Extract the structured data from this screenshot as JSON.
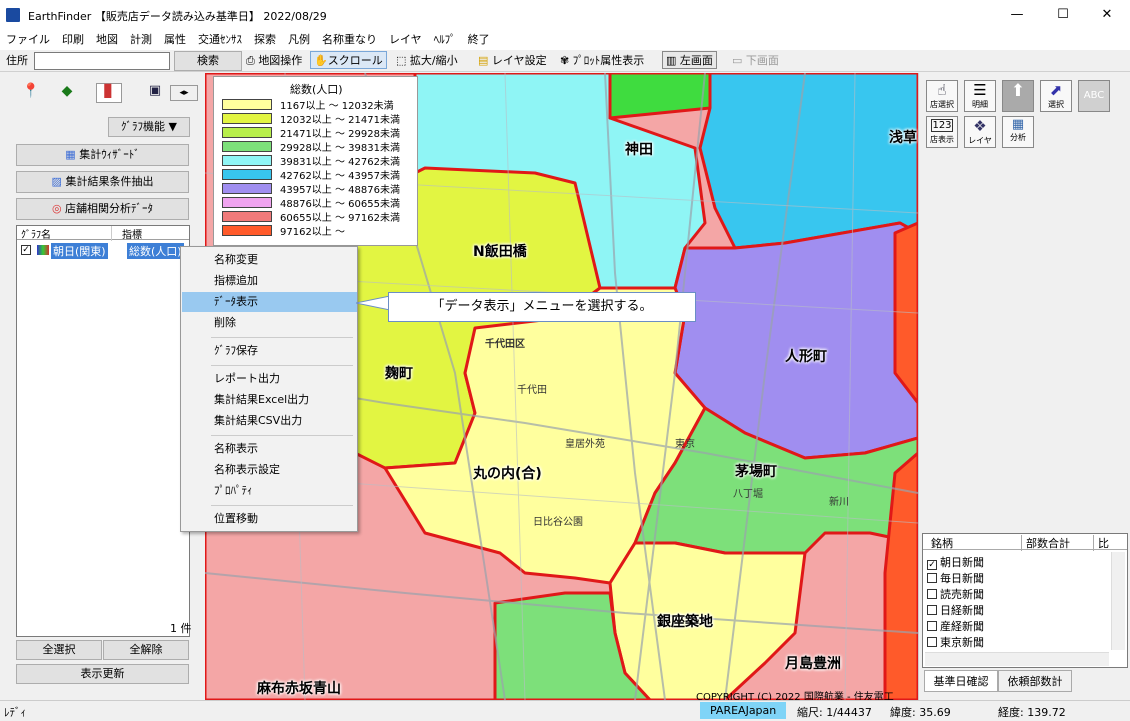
{
  "window": {
    "title": "EarthFinder 【販売店データ読み込み基準日】 2022/08/29",
    "minimize": "—",
    "maximize": "☐",
    "close": "✕"
  },
  "menu": [
    "ファイル",
    "印刷",
    "地図",
    "計測",
    "属性",
    "交通ｾﾝｻｽ",
    "探索",
    "凡例",
    "名称重なり",
    "レイヤ",
    "ﾍﾙﾌﾟ",
    "終了"
  ],
  "toolbar": {
    "address_label": "住所",
    "search": "検索",
    "map_op": "地図操作",
    "scroll": "スクロール",
    "zoom": "拡大/縮小",
    "layer_settings": "レイヤ設定",
    "plot_attr": "ﾌﾟﾛｯﾄ属性表示",
    "left_screen": "左画面",
    "bottom_screen": "下画面"
  },
  "left": {
    "graph_func": "ｸﾞﾗﾌ機能 ▼",
    "wizard": "集計ｳｨｻﾞｰﾄﾞ",
    "extract": "集計結果条件抽出",
    "store_data": "店舗相関分析ﾃﾞｰﾀ",
    "col_graph": "ｸﾞﾗﾌ名",
    "col_index": "指標",
    "row_name": "朝日(関東)",
    "row_index": "総数(人口)",
    "count": "1 件",
    "select_all": "全選択",
    "deselect_all": "全解除",
    "refresh": "表示更新"
  },
  "legend": {
    "title": "総数(人口)",
    "rows": [
      {
        "label": "1167以上 ～ 12032未満",
        "color": "#ffff9e"
      },
      {
        "label": "12032以上 ～ 21471未満",
        "color": "#e2f542"
      },
      {
        "label": "21471以上 ～ 29928未満",
        "color": "#b8ef4a"
      },
      {
        "label": "29928以上 ～ 39831未満",
        "color": "#7de07a"
      },
      {
        "label": "39831以上 ～ 42762未満",
        "color": "#8ff5f5"
      },
      {
        "label": "42762以上 ～ 43957未満",
        "color": "#38c6ef"
      },
      {
        "label": "43957以上 ～ 48876未満",
        "color": "#a08ef0"
      },
      {
        "label": "48876以上 ～ 60655未満",
        "color": "#f0a4f0"
      },
      {
        "label": "60655以上 ～ 97162未満",
        "color": "#f07a7a"
      },
      {
        "label": "97162以上 ～",
        "color": "#ff5a2a"
      }
    ]
  },
  "context_menu": [
    "名称変更",
    "指標追加",
    "ﾃﾞｰﾀ表示",
    "削除",
    "ｸﾞﾗﾌ保存",
    "レポート出力",
    "集計結果Excel出力",
    "集計結果CSV出力",
    "名称表示",
    "名称表示設定",
    "ﾌﾟﾛﾊﾟﾃｨ",
    "位置移動"
  ],
  "callout": "「データ表示」メニューを選択する。",
  "map_labels": {
    "kanda": "神田",
    "iidabashi": "N飯田橋",
    "ningyocho": "人形町",
    "kojimachi": "麹町",
    "marunouchi": "丸の内(合)",
    "kayabacho": "茅場町",
    "ginza": "銀座築地",
    "tsukishima": "月島豊洲",
    "azabu": "麻布赤坂青山",
    "asakusa": "浅草",
    "chiyoda_ku": "千代田区",
    "chiyoda": "千代田",
    "kokyo": "皇居外苑",
    "tokyo": "東京",
    "hachobori": "八丁堀",
    "shinkawa": "新川",
    "hibiya": "日比谷公園"
  },
  "right": {
    "tools": [
      "店選択",
      "明細",
      "",
      "選択",
      "ABC",
      "店表示",
      "レイヤ",
      "分析"
    ],
    "table_cols": [
      "銘柄",
      "部数合計",
      "比"
    ],
    "papers": [
      {
        "name": "朝日新聞",
        "checked": true
      },
      {
        "name": "毎日新聞",
        "checked": false
      },
      {
        "name": "読売新聞",
        "checked": false
      },
      {
        "name": "日経新聞",
        "checked": false
      },
      {
        "name": "産経新聞",
        "checked": false
      },
      {
        "name": "東京新聞",
        "checked": false
      }
    ],
    "tab1": "基準日確認",
    "tab2": "依頼部数計"
  },
  "copyright": "COPYRIGHT (C) 2022 国際航業 - 住友電工",
  "status": {
    "ready": "ﾚﾃﾞｨ",
    "area": "PAREAJapan",
    "scale": "縮尺: 1/44437",
    "lat": "緯度: 35.69",
    "lng": "経度: 139.72"
  }
}
